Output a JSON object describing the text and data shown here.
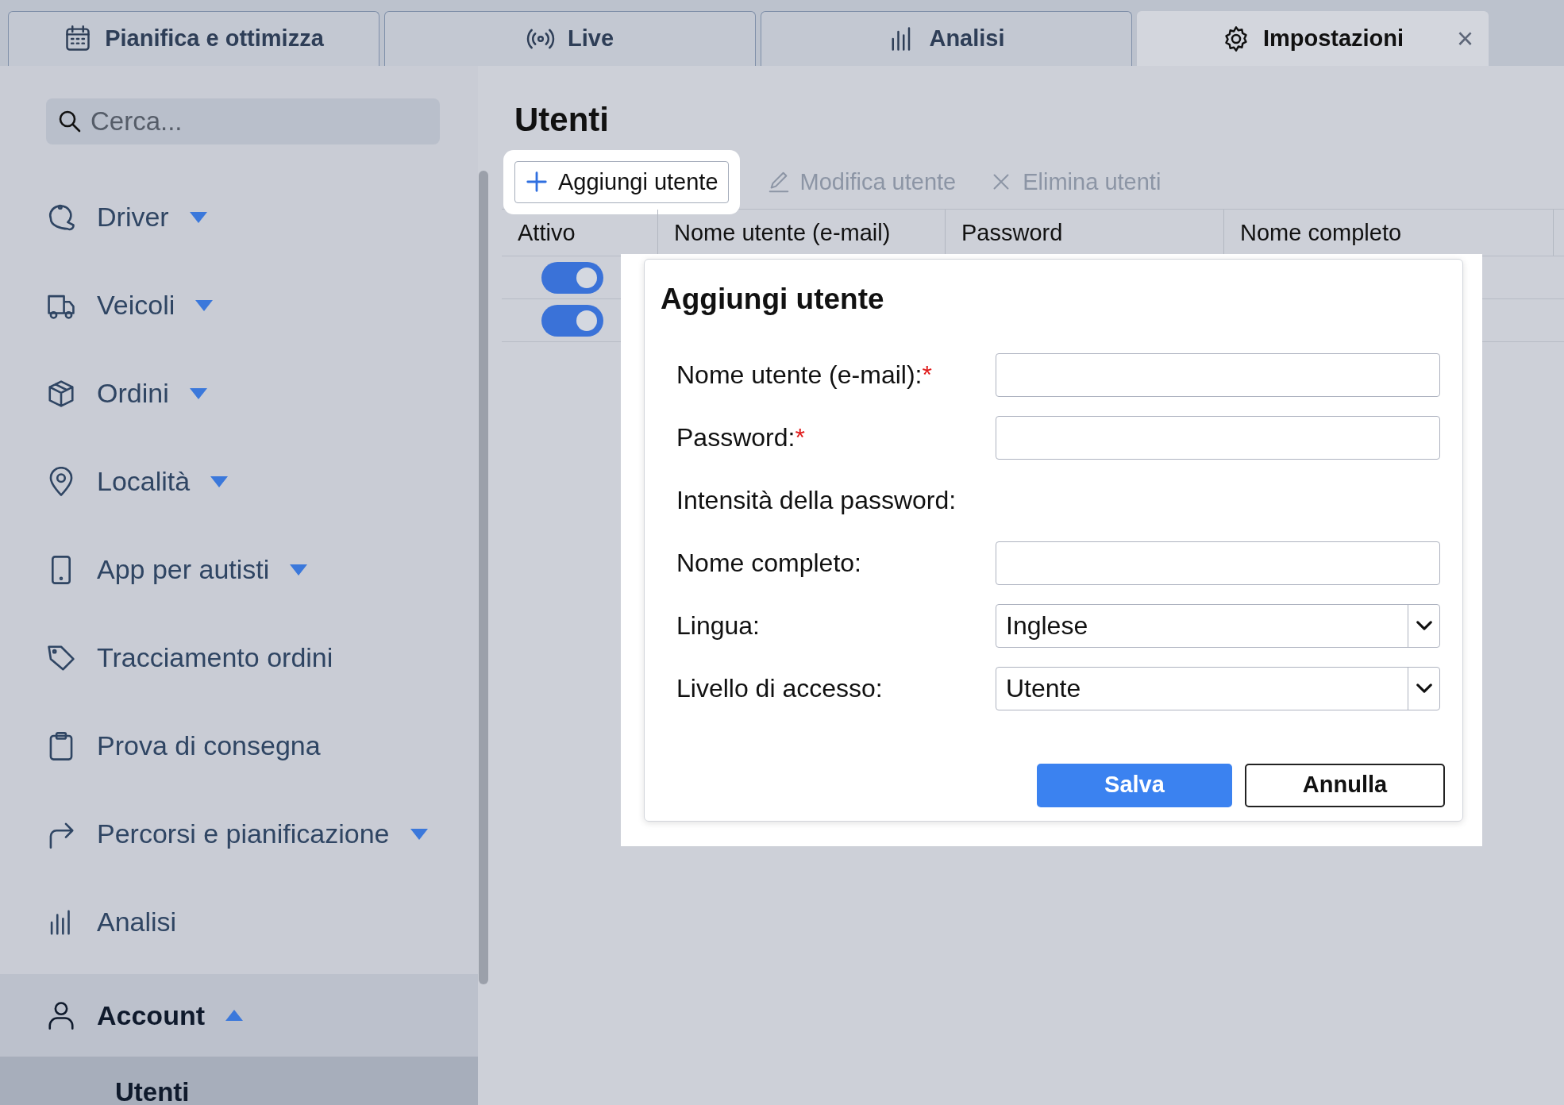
{
  "tabs": [
    {
      "label": "Pianifica e ottimizza",
      "selected": false
    },
    {
      "label": "Live",
      "selected": false
    },
    {
      "label": "Analisi",
      "selected": false
    },
    {
      "label": "Impostazioni",
      "selected": true,
      "close_label": "×"
    }
  ],
  "sidebar": {
    "search": {
      "placeholder": "Cerca..."
    },
    "items": [
      {
        "label": "Driver",
        "kind": "group",
        "expanded": false,
        "selected": false
      },
      {
        "label": "Veicoli",
        "kind": "group",
        "expanded": false,
        "selected": false
      },
      {
        "label": "Ordini",
        "kind": "group",
        "expanded": false,
        "selected": false
      },
      {
        "label": "Località",
        "kind": "group",
        "expanded": false,
        "selected": false
      },
      {
        "label": "App per autisti",
        "kind": "group",
        "expanded": false,
        "selected": false
      },
      {
        "label": "Tracciamento ordini",
        "kind": "link",
        "selected": false
      },
      {
        "label": "Prova di consegna",
        "kind": "link",
        "selected": false
      },
      {
        "label": "Percorsi e pianificazione",
        "kind": "group",
        "expanded": false,
        "selected": false
      },
      {
        "label": "Analisi",
        "kind": "link",
        "selected": false
      },
      {
        "label": "Account",
        "kind": "group",
        "expanded": true,
        "selected": true,
        "children": [
          {
            "label": "Utenti",
            "selected": true
          }
        ]
      }
    ]
  },
  "page": {
    "title": "Utenti",
    "toolbar": [
      {
        "label": "Aggiungi utente",
        "disabled": false,
        "highlighted": true
      },
      {
        "label": "Modifica utente",
        "disabled": true,
        "highlighted": false
      },
      {
        "label": "Elimina utenti",
        "disabled": true,
        "highlighted": false
      }
    ],
    "table": {
      "columns": [
        "Attivo",
        "Nome utente (e-mail)",
        "Password",
        "Nome completo"
      ],
      "rows": [
        {
          "active": true
        },
        {
          "active": true
        }
      ]
    }
  },
  "dialog": {
    "title": "Aggiungi utente",
    "fields": [
      {
        "label": "Nome utente (e-mail):",
        "kind": "text",
        "required": true,
        "required_mark": "*"
      },
      {
        "label": "Password:",
        "kind": "text",
        "required": true,
        "required_mark": "*"
      },
      {
        "label": "Intensità della password:",
        "kind": "info"
      },
      {
        "label": "Nome completo:",
        "kind": "text"
      },
      {
        "label": "Lingua:",
        "kind": "select",
        "value": "Inglese"
      },
      {
        "label": "Livello di accesso:",
        "kind": "select",
        "value": "Utente"
      }
    ],
    "buttons": [
      {
        "label": "Salva",
        "kind": "primary"
      },
      {
        "label": "Annulla",
        "kind": "secondary"
      }
    ]
  }
}
